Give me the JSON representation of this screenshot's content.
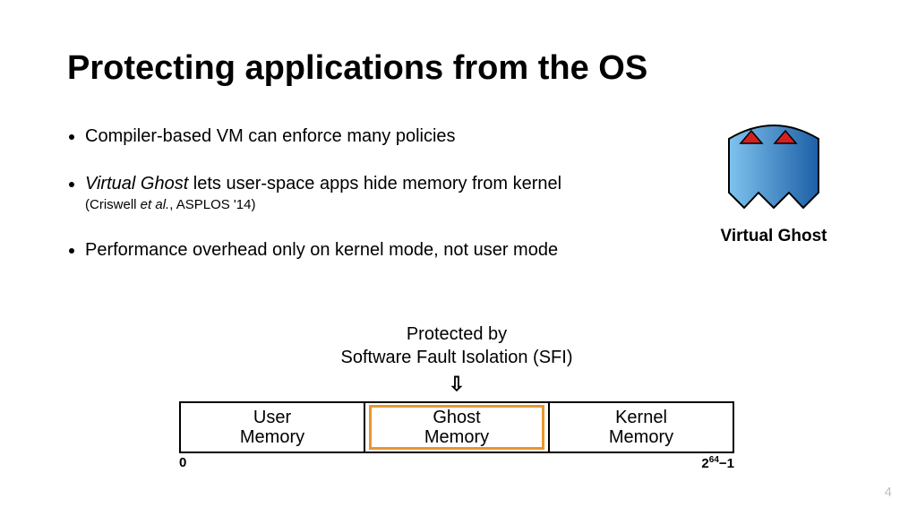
{
  "title": "Protecting applications from the OS",
  "bullets": {
    "b1": "Compiler-based VM can enforce many policies",
    "b2_prefix_italic": "Virtual Ghost",
    "b2_rest": " lets user-space apps hide memory from kernel",
    "b2_citation_prefix": "(Criswell ",
    "b2_citation_italic": "et al.",
    "b2_citation_suffix": ", ASPLOS '14)",
    "b3": "Performance overhead only on kernel mode, not user mode"
  },
  "ghost_label": "Virtual Ghost",
  "sfi": {
    "line1": "Protected by",
    "line2": "Software Fault Isolation (SFI)"
  },
  "memory": {
    "user_l1": "User",
    "user_l2": "Memory",
    "ghost_l1": "Ghost",
    "ghost_l2": "Memory",
    "kernel_l1": "Kernel",
    "kernel_l2": "Memory",
    "axis_start": "0",
    "axis_end_base": "2",
    "axis_end_exp": "64",
    "axis_end_suffix": "−1"
  },
  "page_number": "4"
}
